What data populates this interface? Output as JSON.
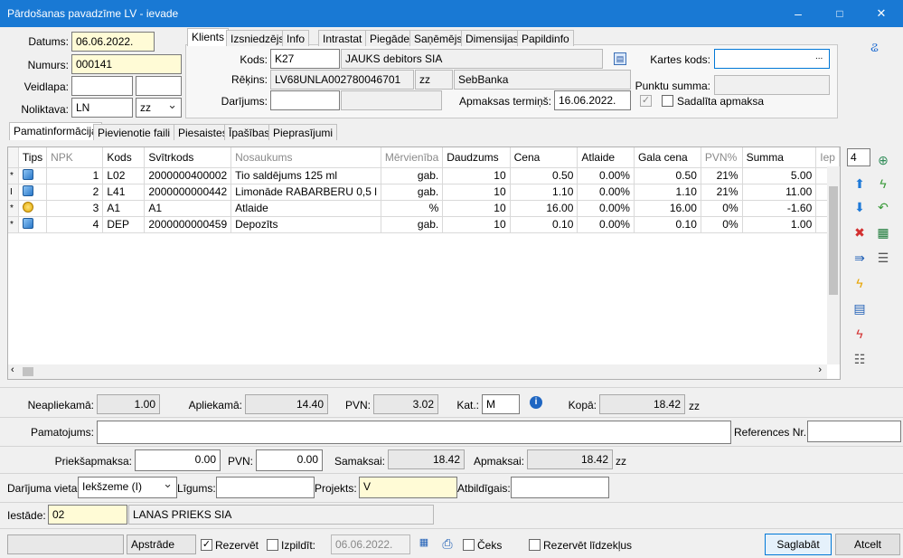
{
  "window": {
    "title": "Pārdošanas pavadzīme LV - ievade",
    "min": "–",
    "max": "□",
    "close": "✕"
  },
  "header": {
    "datums_label": "Datums:",
    "datums": "06.06.2022.",
    "numurs_label": "Numurs:",
    "numurs": "000141",
    "veidlapa_label": "Veidlapa:",
    "veidlapa_a": "",
    "veidlapa_b": "",
    "noliktava_label": "Noliktava:",
    "noliktava": "LN",
    "noliktava_sel": "zz"
  },
  "top_tabs": [
    "Klients",
    "Izsniedzējs",
    "Info",
    "Intrastat",
    "Piegāde",
    "Saņēmējs",
    "Dimensijas",
    "Papildinfo"
  ],
  "klients": {
    "kods_label": "Kods:",
    "kods": "K27",
    "nosaukums": "JAUKS debitors SIA",
    "rekins_label": "Rēķins:",
    "rekins": "LV68UNLA002780046701",
    "rekins_cur": "zz",
    "banka": "SebBanka",
    "darijums_label": "Darījums:",
    "darijums_a": "",
    "darijums_b": "",
    "termins_label": "Apmaksas termiņš:",
    "termins": "16.06.2022.",
    "kartes_label": "Kartes kods:",
    "kartes": "",
    "kartes_btn": "...",
    "punktu_label": "Punktu summa:",
    "punktu": "",
    "sadalita_label": "Sadalīta apmaksa",
    "checked_mark": "✓"
  },
  "main_tabs": [
    "Pamatinformācija",
    "Pievienotie faili",
    "Piesaistes",
    "Īpašības",
    "Pieprasījumi"
  ],
  "grid": {
    "columns": [
      "Tips",
      "NPK",
      "Kods",
      "Svītrkods",
      "Nosaukums",
      "Mērvienība",
      "Daudzums",
      "Cena",
      "Atlaide",
      "Gala cena",
      "PVN%",
      "Summa",
      "Iep"
    ],
    "rows": [
      {
        "marker": "*",
        "icon": "cube",
        "npk": "1",
        "kods": "L02",
        "svitr": "2000000400002",
        "nos": "Tio saldējums 125 ml",
        "mv": "gab.",
        "daudz": "10",
        "cena": "0.50",
        "atl": "0.00%",
        "gala": "0.50",
        "pvn": "21%",
        "summa": "5.00"
      },
      {
        "marker": "I",
        "icon": "cube",
        "npk": "2",
        "kods": "L41",
        "svitr": "2000000000442",
        "nos": "Limonāde RABARBERU 0,5 l",
        "mv": "gab.",
        "daudz": "10",
        "cena": "1.10",
        "atl": "0.00%",
        "gala": "1.10",
        "pvn": "21%",
        "summa": "11.00"
      },
      {
        "marker": "*",
        "icon": "coins",
        "npk": "3",
        "kods": "A1",
        "svitr": "A1",
        "nos": "Atlaide",
        "mv": "%",
        "daudz": "10",
        "cena": "16.00",
        "atl": "0.00%",
        "gala": "16.00",
        "pvn": "0%",
        "summa": "-1.60"
      },
      {
        "marker": "*",
        "icon": "cube",
        "npk": "4",
        "kods": "DEP",
        "svitr": "2000000000459",
        "nos": "Depozīts",
        "mv": "gab.",
        "daudz": "10",
        "cena": "0.10",
        "atl": "0.00%",
        "gala": "0.10",
        "pvn": "0%",
        "summa": "1.00"
      }
    ],
    "row_count": "4"
  },
  "totals": {
    "neapl_label": "Neapliekamā:",
    "neapl": "1.00",
    "apl_label": "Apliekamā:",
    "apl": "14.40",
    "pvn_label": "PVN:",
    "pvn": "3.02",
    "kat_label": "Kat.:",
    "kat": "M",
    "kopa_label": "Kopā:",
    "kopa": "18.42",
    "kopa_cur": "zz",
    "pamatojums_label": "Pamatojums:",
    "pamatojums": "",
    "ref_label": "References Nr.:",
    "ref": "",
    "prieksap_label": "Priekšapmaksa:",
    "prieksap": "0.00",
    "pvn2_label": "PVN:",
    "pvn2": "0.00",
    "samaksai_label": "Samaksai:",
    "samaksai": "18.42",
    "apmaksai_label": "Apmaksai:",
    "apmaksai": "18.42",
    "apmaksai_cur": "zz"
  },
  "extra": {
    "vieta_label": "Darījuma vieta:",
    "vieta": "Iekšzeme (I)",
    "ligums_label": "Līgums:",
    "ligums": "",
    "projekts_label": "Projekts:",
    "projekts": "V",
    "atbildigais_label": "Atbildīgais:",
    "atbildigais": "",
    "iestade_label": "Iestāde:",
    "iestade": "02",
    "iestade_nos": "LANAS PRIEKS SIA"
  },
  "footer": {
    "status": "",
    "apstrade": "Apstrāde",
    "rezervet_label": "Rezervēt",
    "izpildit_label": "Izpildīt:",
    "izpildit_date": "06.06.2022.",
    "ceks_label": "Čeks",
    "rezervet_lidz_label": "Rezervēt līdzekļus",
    "save": "Saglabāt",
    "cancel": "Atcelt"
  },
  "colors": {
    "titlebar": "#1979d4",
    "yellow": "#fffbd6",
    "accent": "#0078d7"
  }
}
